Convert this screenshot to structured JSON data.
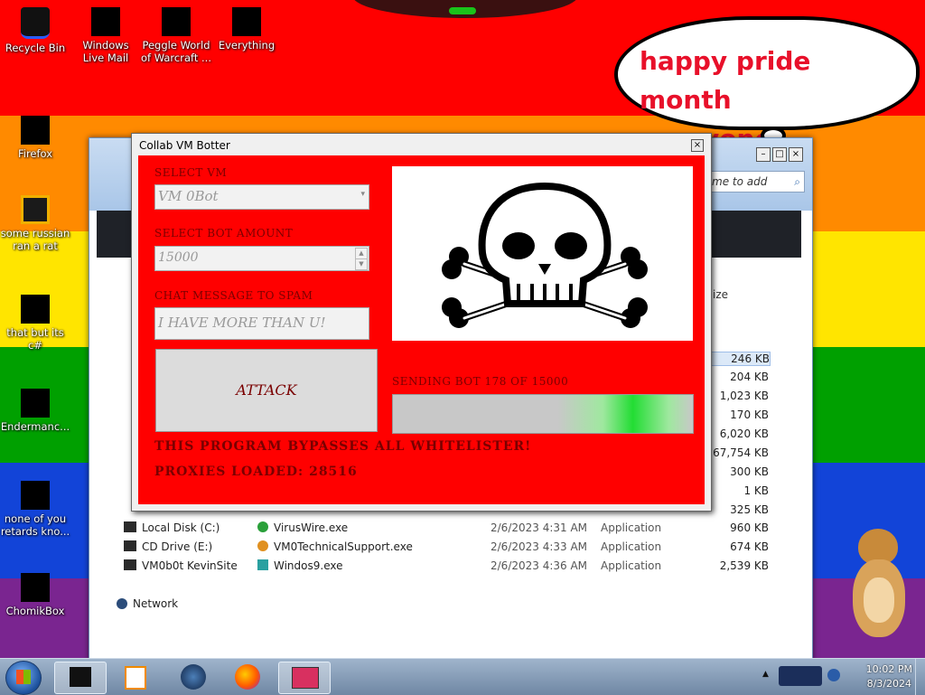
{
  "desktop": {
    "stripes": [
      "#ff0000",
      "#ff8a00",
      "#ffe500",
      "#00a000",
      "#1244d8",
      "#7a2590"
    ],
    "icons": [
      {
        "label": "Recycle Bin",
        "icon": "recycle-bin-icon"
      },
      {
        "label": "Windows Live Mail",
        "icon": "mail-icon"
      },
      {
        "label": "Peggle World of Warcraft ...",
        "icon": "game-icon"
      },
      {
        "label": "Everything",
        "icon": "search-icon"
      },
      {
        "label": "Firefox",
        "icon": "firefox-icon"
      },
      {
        "label": "some russian ran a rat",
        "icon": "app-icon"
      },
      {
        "label": "that but its c#",
        "icon": "app-icon"
      },
      {
        "label": "Endermanc...",
        "icon": "app-icon"
      },
      {
        "label": "none of you retards kno...",
        "icon": "app-icon"
      },
      {
        "label": "ChomikBox",
        "icon": "chomikbox-icon"
      }
    ],
    "bubble_text": "happy pride month everyone!"
  },
  "explorer": {
    "search_placeholder": "me to add",
    "size_header": "ize",
    "sizes": [
      "246 KB",
      "204 KB",
      "1,023 KB",
      "170 KB",
      "6,020 KB",
      "67,754 KB",
      "300 KB",
      "1 KB",
      "325 KB"
    ],
    "nav": [
      {
        "label": "Local Disk (C:)",
        "icon": "disk-icon"
      },
      {
        "label": "CD Drive (E:)",
        "icon": "cd-drive-icon"
      },
      {
        "label": "VM0b0t KevinSite",
        "icon": "network-drive-icon"
      },
      {
        "label": "Network",
        "icon": "network-icon"
      }
    ],
    "files": [
      {
        "name": "VirusWire.exe",
        "date": "2/6/2023 4:31 AM",
        "type": "Application",
        "size": "960 KB"
      },
      {
        "name": "VM0TechnicalSupport.exe",
        "date": "2/6/2023 4:33 AM",
        "type": "Application",
        "size": "674 KB"
      },
      {
        "name": "Windos9.exe",
        "date": "2/6/2023 4:36 AM",
        "type": "Application",
        "size": "2,539 KB"
      }
    ]
  },
  "botter": {
    "title": "Collab VM Botter",
    "select_vm_label": "SELECT VM",
    "select_vm_value": "VM 0Bot",
    "bot_amount_label": "SELECT BOT AMOUNT",
    "bot_amount_value": "15000",
    "chat_label": "CHAT MESSAGE TO SPAM",
    "chat_value": "I HAVE MORE THAN U!",
    "attack_label": "ATTACK",
    "status": "SENDING BOT 178 OF 15000",
    "progress": 0.0119,
    "bypass_text": "THIS PROGRAM BYPASSES ALL WHITELISTER!",
    "proxies_text": "PROXIES LOADED: 28516",
    "image_icon": "skull-and-crossbones-icon"
  },
  "taskbar": {
    "time": "10:02 PM",
    "date": "8/3/2024",
    "buttons": [
      "start-icon",
      "app-icon",
      "media-player-icon",
      "network-icon",
      "firefox-icon",
      "app-icon"
    ]
  }
}
